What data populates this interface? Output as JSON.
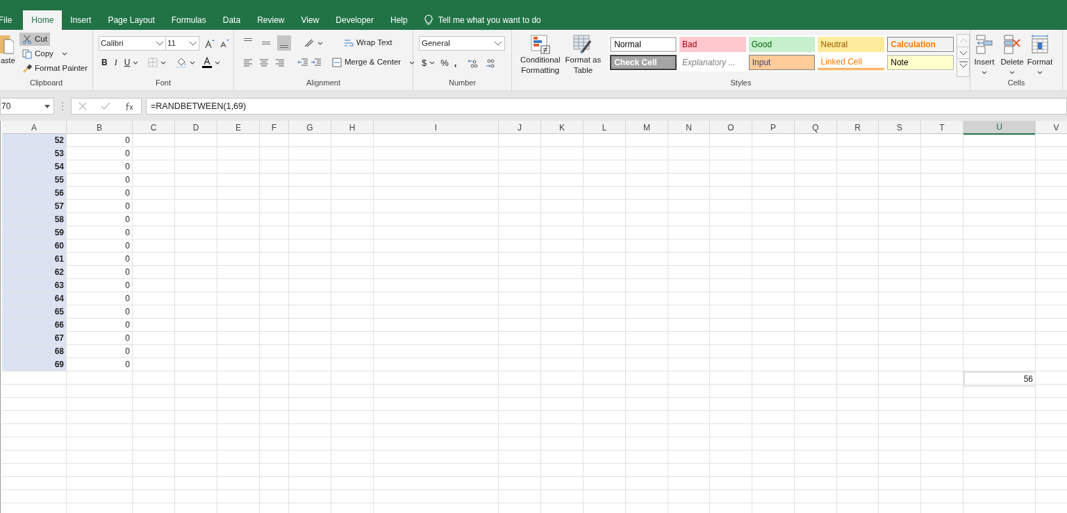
{
  "tabs": [
    {
      "label": "File",
      "selected": false
    },
    {
      "label": "Home",
      "selected": true
    },
    {
      "label": "Insert",
      "selected": false
    },
    {
      "label": "Page Layout",
      "selected": false
    },
    {
      "label": "Formulas",
      "selected": false
    },
    {
      "label": "Data",
      "selected": false
    },
    {
      "label": "Review",
      "selected": false
    },
    {
      "label": "View",
      "selected": false
    },
    {
      "label": "Developer",
      "selected": false
    },
    {
      "label": "Help",
      "selected": false
    }
  ],
  "tell_me": "Tell me what you want to do",
  "clipboard": {
    "paste": "aste",
    "cut": {
      "label": "Cut",
      "highlighted": true
    },
    "copy": "Copy",
    "format_painter": "Format Painter",
    "group": "Clipboard"
  },
  "font": {
    "name": "Calibri",
    "size": "11",
    "bold": "B",
    "italic": "I",
    "underline": "U",
    "group": "Font"
  },
  "alignment": {
    "vertical_buttons": [
      {
        "kind": "top",
        "on": false
      },
      {
        "kind": "middle",
        "on": false
      },
      {
        "kind": "bottom",
        "on": true
      }
    ],
    "wrap_text": "Wrap Text",
    "merge_center": "Merge & Center",
    "group": "Alignment"
  },
  "number": {
    "format": "General",
    "currency": "$",
    "percent": "%",
    "comma": ",",
    "group": "Number"
  },
  "styles": {
    "conditional_formatting": "Conditional Formatting",
    "format_as_table": "Format as Table",
    "group": "Styles",
    "gallery": [
      {
        "kind": "normal",
        "label": "Normal"
      },
      {
        "kind": "bad",
        "label": "Bad"
      },
      {
        "kind": "good",
        "label": "Good"
      },
      {
        "kind": "neutral",
        "label": "Neutral"
      },
      {
        "kind": "calculation",
        "label": "Calculation"
      },
      {
        "kind": "check",
        "label": "Check Cell"
      },
      {
        "kind": "explanatory",
        "label": "Explanatory ..."
      },
      {
        "kind": "input",
        "label": "Input"
      },
      {
        "kind": "linked",
        "label": "Linked Cell"
      },
      {
        "kind": "note",
        "label": "Note"
      }
    ]
  },
  "cells": {
    "buttons": [
      {
        "kind": "insert",
        "label": "Insert"
      },
      {
        "kind": "delete",
        "label": "Delete"
      },
      {
        "kind": "format",
        "label": "Format"
      }
    ],
    "group": "Cells"
  },
  "formula_bar": {
    "name_box": "70",
    "formula": "=RANDBETWEEN(1,69)"
  },
  "sheet": {
    "columns": [
      {
        "label": "A",
        "selected": false
      },
      {
        "label": "B",
        "selected": false
      },
      {
        "label": "C",
        "selected": false
      },
      {
        "label": "D",
        "selected": false
      },
      {
        "label": "E",
        "selected": false
      },
      {
        "label": "F",
        "selected": false
      },
      {
        "label": "G",
        "selected": false
      },
      {
        "label": "H",
        "selected": false
      },
      {
        "label": "I",
        "selected": false
      },
      {
        "label": "J",
        "selected": false
      },
      {
        "label": "K",
        "selected": false
      },
      {
        "label": "L",
        "selected": false
      },
      {
        "label": "M",
        "selected": false
      },
      {
        "label": "N",
        "selected": false
      },
      {
        "label": "O",
        "selected": false
      },
      {
        "label": "P",
        "selected": false
      },
      {
        "label": "Q",
        "selected": false
      },
      {
        "label": "R",
        "selected": false
      },
      {
        "label": "S",
        "selected": false
      },
      {
        "label": "T",
        "selected": false
      },
      {
        "label": "U",
        "selected": true
      },
      {
        "label": "V",
        "selected": false
      }
    ],
    "rows": [
      {
        "a": {
          "value": "52",
          "shaded": true
        },
        "b": {
          "value": "0"
        }
      },
      {
        "a": {
          "value": "53",
          "shaded": true
        },
        "b": {
          "value": "0"
        }
      },
      {
        "a": {
          "value": "54",
          "shaded": true
        },
        "b": {
          "value": "0"
        }
      },
      {
        "a": {
          "value": "55",
          "shaded": true
        },
        "b": {
          "value": "0"
        }
      },
      {
        "a": {
          "value": "56",
          "shaded": true
        },
        "b": {
          "value": "0"
        }
      },
      {
        "a": {
          "value": "57",
          "shaded": true
        },
        "b": {
          "value": "0"
        }
      },
      {
        "a": {
          "value": "58",
          "shaded": true
        },
        "b": {
          "value": "0"
        }
      },
      {
        "a": {
          "value": "59",
          "shaded": true
        },
        "b": {
          "value": "0"
        }
      },
      {
        "a": {
          "value": "60",
          "shaded": true
        },
        "b": {
          "value": "0"
        }
      },
      {
        "a": {
          "value": "61",
          "shaded": true
        },
        "b": {
          "value": "0"
        }
      },
      {
        "a": {
          "value": "62",
          "shaded": true
        },
        "b": {
          "value": "0"
        }
      },
      {
        "a": {
          "value": "63",
          "shaded": true
        },
        "b": {
          "value": "0"
        }
      },
      {
        "a": {
          "value": "64",
          "shaded": true
        },
        "b": {
          "value": "0"
        }
      },
      {
        "a": {
          "value": "65",
          "shaded": true
        },
        "b": {
          "value": "0"
        }
      },
      {
        "a": {
          "value": "66",
          "shaded": true
        },
        "b": {
          "value": "0"
        }
      },
      {
        "a": {
          "value": "67",
          "shaded": true
        },
        "b": {
          "value": "0"
        }
      },
      {
        "a": {
          "value": "68",
          "shaded": true
        },
        "b": {
          "value": "0"
        }
      },
      {
        "a": {
          "value": "69",
          "shaded": true
        },
        "b": {
          "value": "0"
        }
      },
      {
        "u": {
          "value": "56",
          "selected": true
        }
      }
    ]
  }
}
